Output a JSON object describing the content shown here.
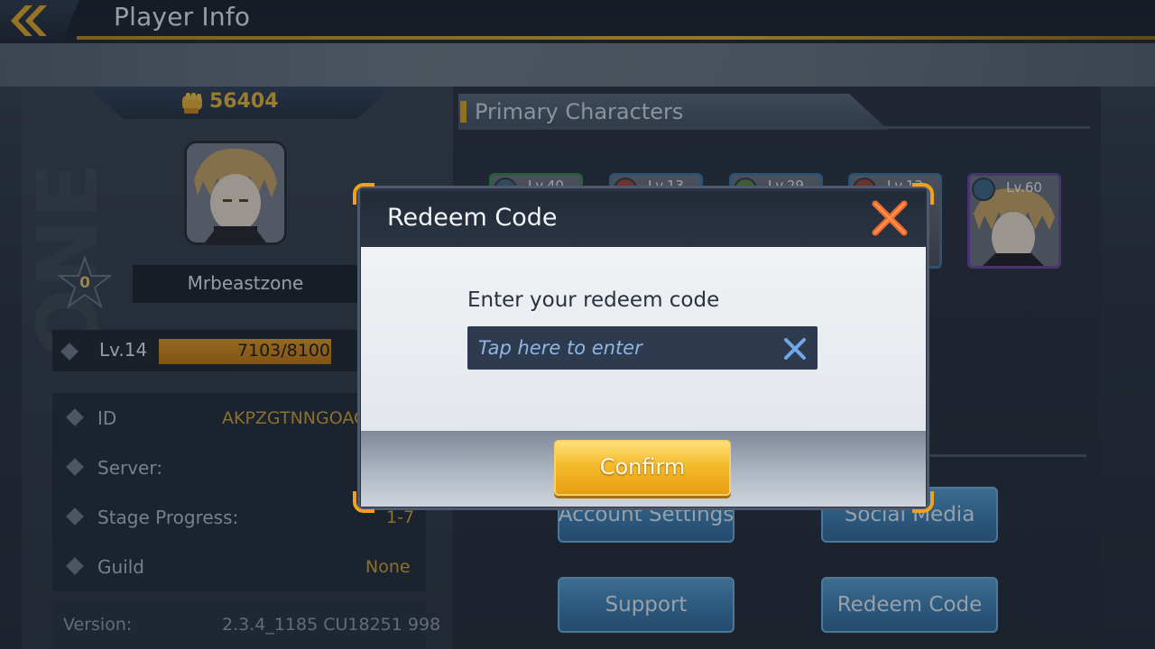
{
  "header": {
    "title": "Player Info",
    "back_icon": "double-chevron-left-icon"
  },
  "profile": {
    "watermark": "ONE",
    "power": "56404",
    "power_icon": "fist-icon",
    "rank": "0",
    "name": "Mrbeastzone",
    "level": "Lv.14",
    "xp": "7103/8100",
    "xp_fraction": 0.877,
    "details": [
      {
        "label": "ID",
        "value": "AKPZGTNNGOAG"
      },
      {
        "label": "Server:",
        "value": ""
      },
      {
        "label": "Stage Progress:",
        "value": "1-7"
      },
      {
        "label": "Guild",
        "value": "None"
      }
    ],
    "version_label": "Version:",
    "version_value": "2.3.4_1185 CU18251 998"
  },
  "primary_characters": {
    "title": "Primary Characters",
    "cards": [
      {
        "level": "Lv.40"
      },
      {
        "level": "Lv.13"
      },
      {
        "level": "Lv.29"
      },
      {
        "level": "Lv.13"
      },
      {
        "level": "Lv.60"
      }
    ]
  },
  "menu_buttons": {
    "account_settings": "Account Settings",
    "social_media": "Social Media",
    "support": "Support",
    "redeem_code": "Redeem Code"
  },
  "modal": {
    "title": "Redeem Code",
    "prompt": "Enter your redeem code",
    "input_placeholder": "Tap here to enter",
    "confirm_label": "Confirm",
    "close_icon": "close-icon",
    "clear_icon": "clear-input-icon"
  },
  "colors": {
    "accent_gold": "#e1b13b",
    "confirm_orange": "#f4bb2b",
    "close_red": "#f0572a",
    "button_blue": "#4a8fc4"
  }
}
